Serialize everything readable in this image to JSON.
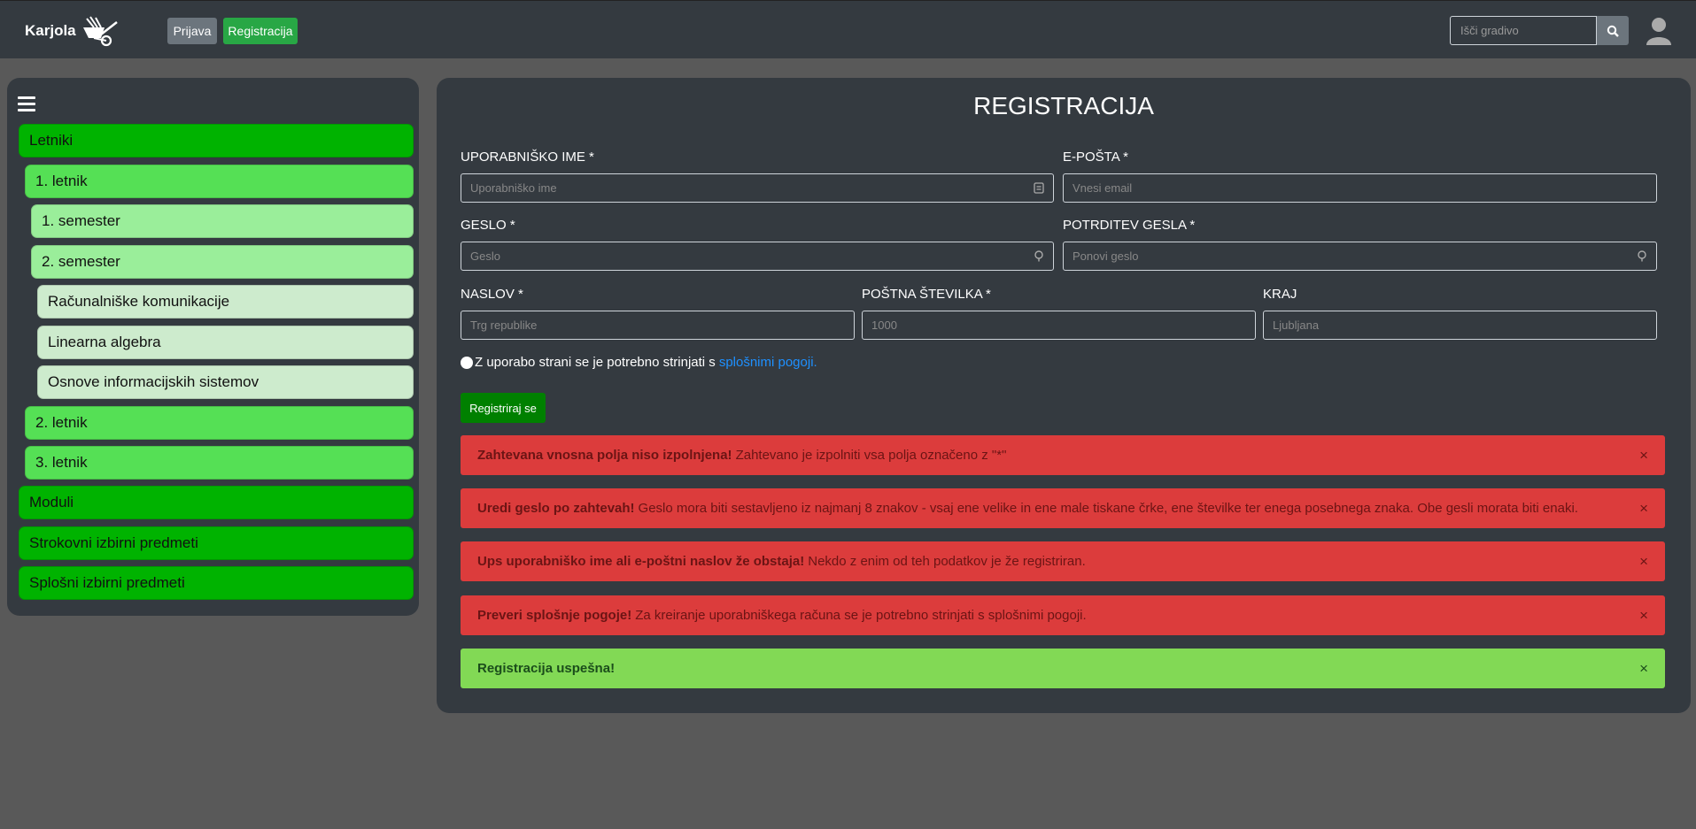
{
  "navbar": {
    "brand": "Karjola",
    "login_label": "Prijava",
    "register_label": "Registracija",
    "search_placeholder": "Išči gradivo"
  },
  "sidebar": {
    "items": [
      {
        "label": "Letniki",
        "level": 0
      },
      {
        "label": "1. letnik",
        "level": 1
      },
      {
        "label": "1. semester",
        "level": 2
      },
      {
        "label": "2. semester",
        "level": 2
      },
      {
        "label": "Računalniške komunikacije",
        "level": 3
      },
      {
        "label": "Linearna algebra",
        "level": 3
      },
      {
        "label": "Osnove informacijskih sistemov",
        "level": 3
      },
      {
        "label": "2. letnik",
        "level": 1
      },
      {
        "label": "3. letnik",
        "level": 1
      },
      {
        "label": "Moduli",
        "level": 0
      },
      {
        "label": "Strokovni izbirni predmeti",
        "level": 0
      },
      {
        "label": "Splošni izbirni predmeti",
        "level": 0
      }
    ]
  },
  "form": {
    "title": "REGISTRACIJA",
    "username_label": "UPORABNIŠKO IME *",
    "username_placeholder": "Uporabniško ime",
    "email_label": "E-POŠTA *",
    "email_placeholder": "Vnesi email",
    "password_label": "GESLO *",
    "password_placeholder": "Geslo",
    "confirm_label": "POTRDITEV GESLA *",
    "confirm_placeholder": "Ponovi geslo",
    "address_label": "NASLOV *",
    "address_placeholder": "Trg republike",
    "postal_label": "POŠTNA ŠTEVILKA *",
    "postal_placeholder": "1000",
    "city_label": "KRAJ",
    "city_placeholder": "Ljubljana",
    "terms_text": "Z uporabo strani se je potrebno strinjati s",
    "terms_link": "splošnimi pogoji.",
    "submit_label": "Registriraj se"
  },
  "alerts": [
    {
      "type": "danger",
      "title": "Zahtevana vnosna polja niso izpolnjena!",
      "text": "Zahtevano je izpolniti vsa polja označeno z \"*\""
    },
    {
      "type": "danger",
      "title": "Uredi geslo po zahtevah!",
      "text": "Geslo mora biti sestavljeno iz najmanj 8 znakov - vsaj ene velike in ene male tiskane črke, ene številke ter enega posebnega znaka. Obe gesli morata biti enaki."
    },
    {
      "type": "danger",
      "title": "Ups uporabniško ime ali e-poštni naslov že obstaja!",
      "text": "Nekdo z enim od teh podatkov je že registriran."
    },
    {
      "type": "danger",
      "title": "Preveri splošnje pogoje!",
      "text": "Za kreiranje uporabniškega računa se je potrebno strinjati s splošnimi pogoji."
    },
    {
      "type": "success",
      "title": "Registracija uspešna!",
      "text": ""
    }
  ],
  "alert_close": "×",
  "colors": {
    "navbar": "#343a40",
    "page_bg": "#595959",
    "success_btn": "#28a745",
    "danger_alert": "#dc3c3c",
    "success_alert": "#82d955"
  }
}
